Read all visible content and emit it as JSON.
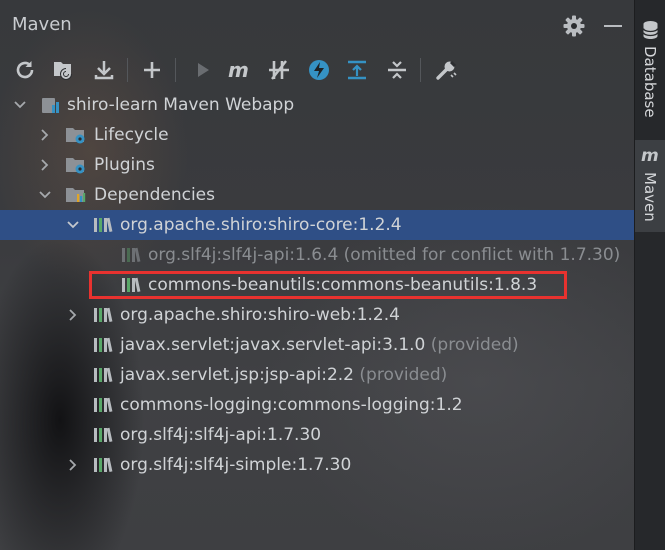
{
  "panel": {
    "title": "Maven"
  },
  "toolbar": {
    "buttons": [
      "reload-icon",
      "generate-sources-icon",
      "download-icon",
      "add-icon",
      "run-icon",
      "execute-goal-icon",
      "toggle-offline-icon",
      "skip-tests-icon",
      "show-dependencies-icon",
      "collapse-all-icon",
      "settings-icon"
    ]
  },
  "tree": {
    "root": "shiro-learn Maven Webapp",
    "lifecycle": "Lifecycle",
    "plugins": "Plugins",
    "dependencies": "Dependencies",
    "deps": {
      "shiro_core": "org.apache.shiro:shiro-core:1.2.4",
      "slf4j_api_omitted": "org.slf4j:slf4j-api:1.6.4 (omitted for conflict with 1.7.30)",
      "beanutils": "commons-beanutils:commons-beanutils:1.8.3",
      "shiro_web": "org.apache.shiro:shiro-web:1.2.4",
      "servlet_api": "javax.servlet:javax.servlet-api:3.1.0",
      "servlet_api_scope": "(provided)",
      "jsp_api": "javax.servlet.jsp:jsp-api:2.2",
      "jsp_api_scope": "(provided)",
      "commons_logging": "commons-logging:commons-logging:1.2",
      "slf4j_api": "org.slf4j:slf4j-api:1.7.30",
      "slf4j_simple": "org.slf4j:slf4j-simple:1.7.30"
    }
  },
  "side_tabs": {
    "database": "Database",
    "maven": "Maven"
  },
  "colors": {
    "selection": "#2f4f86",
    "highlight_border": "#e8322f",
    "accent_blue": "#3592c4"
  }
}
